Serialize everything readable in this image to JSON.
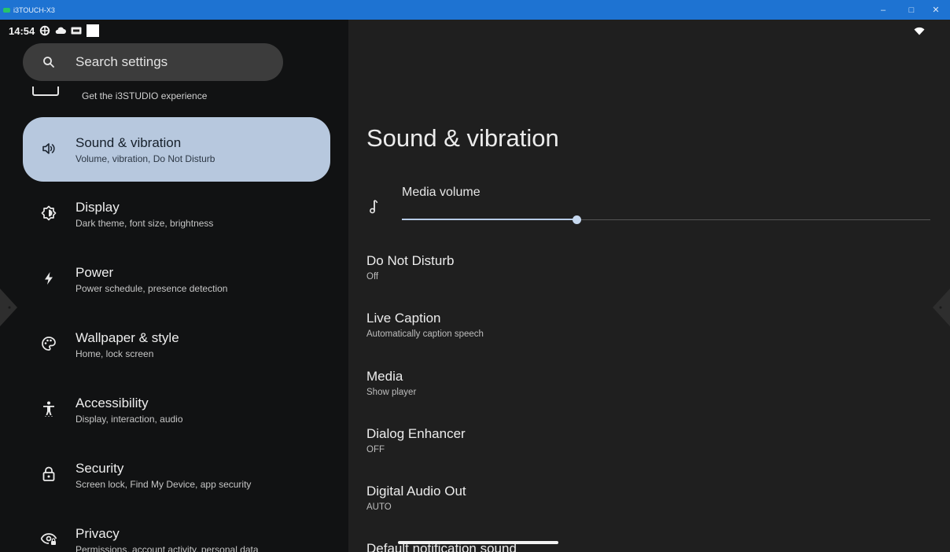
{
  "window": {
    "title": "i3TOUCH-X3",
    "minimize_glyph": "–",
    "maximize_glyph": "□",
    "close_glyph": "✕"
  },
  "statusbar": {
    "time": "14:54",
    "icons": [
      "settings-cog-icon",
      "cloud-icon",
      "dvr-badge-icon",
      "white-square-icon",
      "wifi-icon"
    ]
  },
  "search": {
    "placeholder": "Search settings"
  },
  "partial_item": {
    "subtitle": "Get the i3STUDIO experience"
  },
  "menu": [
    {
      "title": "Sound & vibration",
      "subtitle": "Volume, vibration, Do Not Disturb",
      "icon": "speaker-icon",
      "selected": true
    },
    {
      "title": "Display",
      "subtitle": "Dark theme, font size, brightness",
      "icon": "brightness-icon"
    },
    {
      "title": "Power",
      "subtitle": "Power schedule, presence detection",
      "icon": "bolt-icon"
    },
    {
      "title": "Wallpaper & style",
      "subtitle": "Home, lock screen",
      "icon": "palette-icon"
    },
    {
      "title": "Accessibility",
      "subtitle": "Display, interaction, audio",
      "icon": "accessibility-icon"
    },
    {
      "title": "Security",
      "subtitle": "Screen lock, Find My Device, app security",
      "icon": "lock-icon"
    },
    {
      "title": "Privacy",
      "subtitle": "Permissions, account activity, personal data",
      "icon": "privacy-eye-icon"
    }
  ],
  "detail": {
    "title": "Sound & vibration",
    "media_volume": {
      "label": "Media volume",
      "value_fraction": 0.33
    },
    "settings": [
      {
        "title": "Do Not Disturb",
        "subtitle": "Off"
      },
      {
        "title": "Live Caption",
        "subtitle": "Automatically caption speech"
      },
      {
        "title": "Media",
        "subtitle": "Show player"
      },
      {
        "title": "Dialog Enhancer",
        "subtitle": "OFF"
      },
      {
        "title": "Digital Audio Out",
        "subtitle": "AUTO"
      },
      {
        "title": "Default notification sound",
        "subtitle": ""
      }
    ]
  },
  "colors": {
    "titlebar": "#1e73d2",
    "selected_item": "#b7c8de",
    "slider_fill": "#b6cbe6"
  }
}
